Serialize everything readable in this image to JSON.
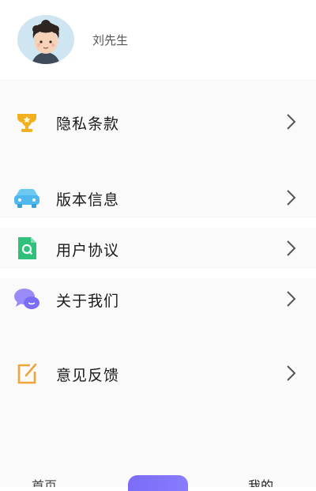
{
  "profile": {
    "username": "刘先生"
  },
  "menu": [
    {
      "label": "隐私条款",
      "icon": "trophy-icon",
      "color": "#f2b01e"
    },
    {
      "label": "版本信息",
      "icon": "car-icon",
      "color": "#4fb8ec"
    },
    {
      "label": "用户协议",
      "icon": "document-search-icon",
      "color": "#2fc07a"
    },
    {
      "label": "关于我们",
      "icon": "chat-bubbles-icon",
      "color": "#7a6cf6"
    },
    {
      "label": "意见反馈",
      "icon": "edit-icon",
      "color": "#f0a43a"
    }
  ],
  "tabbar": {
    "home_label": "首页",
    "mine_label": "我的",
    "accent": "#7a6cf6"
  }
}
